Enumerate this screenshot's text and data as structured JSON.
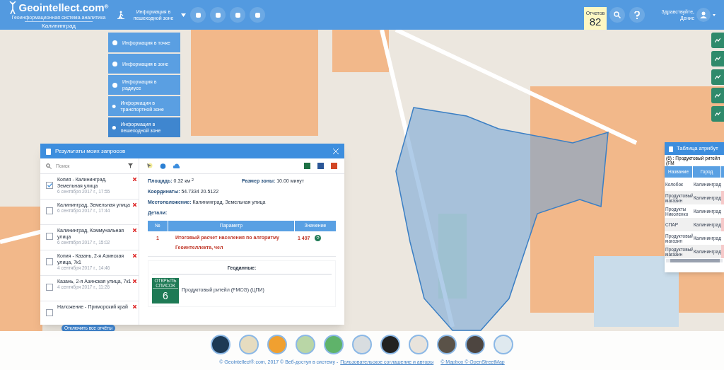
{
  "header": {
    "logo": "Geointellect.com",
    "logo_mark": "®",
    "logo_subtitle": "Геоинформационная система аналитика",
    "city": "Калининград",
    "mode": "Информация в пешеходной зоне",
    "reports_label": "Отчетов",
    "reports_count": "82",
    "greeting": "Здравствуйте, Денис"
  },
  "tools_menu": [
    {
      "label": "Информация в точке",
      "selected": false
    },
    {
      "label": "Информация в зоне",
      "selected": false
    },
    {
      "label": "Информация в радиусе",
      "selected": false
    },
    {
      "label": "Информация в транспортной зоне",
      "selected": false
    },
    {
      "label": "Информация в пешеходной зоне",
      "selected": true
    }
  ],
  "results": {
    "title": "Результаты моих запросов",
    "search_placeholder": "Поиск",
    "items": [
      {
        "title": "Копия - Калининград, Земельная улица",
        "date": "6 сентября 2017 г., 17:55",
        "checked": true
      },
      {
        "title": "Калининград, Земельная улица",
        "date": "6 сентября 2017 г., 17:44",
        "checked": false
      },
      {
        "title": "Калининград, Коммунальная улица",
        "date": "6 сентября 2017 г., 15:02",
        "checked": false
      },
      {
        "title": "Копия - Казань, 2-я Азинская улица, 7к1",
        "date": "4 сентября 2017 г., 14:46",
        "checked": false
      },
      {
        "title": "Казань, 2-я Азинская улица, 7к1",
        "date": "4 сентября 2017 г., 11:26",
        "checked": false
      },
      {
        "title": "Наложение - Приморский край",
        "checked": false
      }
    ],
    "disable_all": "Отключить все отчёты",
    "fields": [
      {
        "label": "Площадь:",
        "value": "0.32 км $^{2}$"
      },
      {
        "label": "Размер зоны:",
        "value": "10.00 минут"
      },
      {
        "label": "Координаты:",
        "value": "54.7334  20.5122"
      },
      {
        "label": "Местоположение:",
        "value": "Калининград, Земельная улица"
      },
      {
        "label": "Детали:"
      }
    ],
    "table": {
      "columns": [
        "№",
        "Параметр",
        "Значение"
      ],
      "rows": [
        {
          "num": "1",
          "param": "Итоговый расчет населения по алгоритму Геоинтеллекта, чел",
          "value": "1 497"
        }
      ]
    },
    "geodata": {
      "title": "Геоданные:",
      "badge_label": "ОТКРЫТЬ СПИСОК",
      "badge_count": "6",
      "layer": "Продуктовый ритейл (FMCG) (ЦПИ)"
    }
  },
  "attributes": {
    "title": "Таблица атрибут",
    "subtitle": "(6) : Продуктовый ритейл (FM",
    "columns": [
      "Название",
      "Город"
    ],
    "rows": [
      [
        "Колобок",
        "Калининград"
      ],
      [
        "Продуктовый магазин",
        "Калининград"
      ],
      [
        "Продукты Николенко",
        "Калининград"
      ],
      [
        "СПАР",
        "Калининград"
      ],
      [
        "Продуктовый магазин",
        "Калининград"
      ],
      [
        "Продуктовый магазин",
        "Калининград"
      ]
    ]
  },
  "basemaps": [
    {
      "color": "#1d3a55"
    },
    {
      "color": "#e6dcc0"
    },
    {
      "color": "#f0a030"
    },
    {
      "color": "#b9d6a6"
    },
    {
      "color": "#5fb36a"
    },
    {
      "color": "#d8dde0"
    },
    {
      "color": "#222222"
    },
    {
      "color": "#e8e3dc"
    },
    {
      "color": "#5a5248"
    },
    {
      "color": "#4d4540"
    },
    {
      "color": "#dfe9ef"
    }
  ],
  "footer": {
    "copyright": "© Geointellect®.com, 2017 © Веб-доступ в систему -",
    "agreement_link": "Пользовательское соглашение и авторы",
    "attribution": "© Mapbox © OpenStreetMap"
  }
}
